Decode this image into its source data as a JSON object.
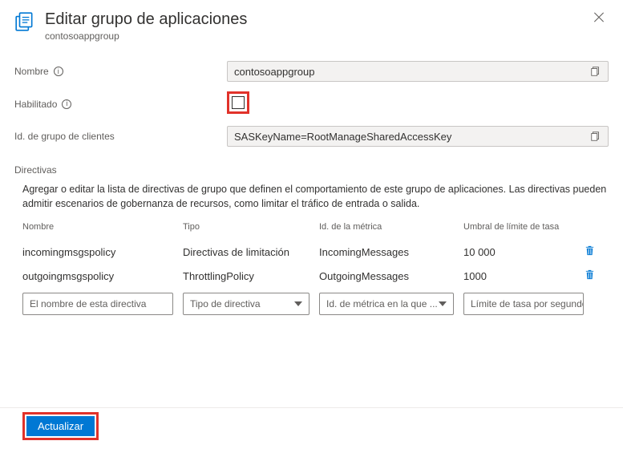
{
  "header": {
    "title": "Editar grupo de aplicaciones",
    "subtitle": "contosoappgroup"
  },
  "form": {
    "name_label": "Nombre",
    "name_value": "contosoappgroup",
    "enabled_label": "Habilitado",
    "client_group_label": "Id. de grupo de clientes",
    "client_group_value": "SASKeyName=RootManageSharedAccessKey"
  },
  "policies": {
    "section_title": "Directivas",
    "description": "Agregar o editar la lista de directivas de grupo que definen el comportamiento de este grupo de aplicaciones. Las directivas pueden admitir escenarios de gobernanza de recursos, como limitar el tráfico de entrada o salida.",
    "columns": {
      "name": "Nombre",
      "type": "Tipo",
      "metric": "Id. de la métrica",
      "threshold": "Umbral de límite de tasa"
    },
    "rows": [
      {
        "name": "incomingmsgspolicy",
        "type": "Directivas de limitación",
        "metric": "IncomingMessages",
        "threshold": "10 000"
      },
      {
        "name": "outgoingmsgspolicy",
        "type": "ThrottlingPolicy",
        "metric": "OutgoingMessages",
        "threshold": "1000"
      }
    ],
    "inputs": {
      "name_ph": "El nombre de esta directiva",
      "type_ph": "Tipo de directiva",
      "metric_ph": "Id. de métrica en la que ...",
      "threshold_ph": "Límite de tasa por segundo"
    }
  },
  "footer": {
    "update": "Actualizar"
  }
}
